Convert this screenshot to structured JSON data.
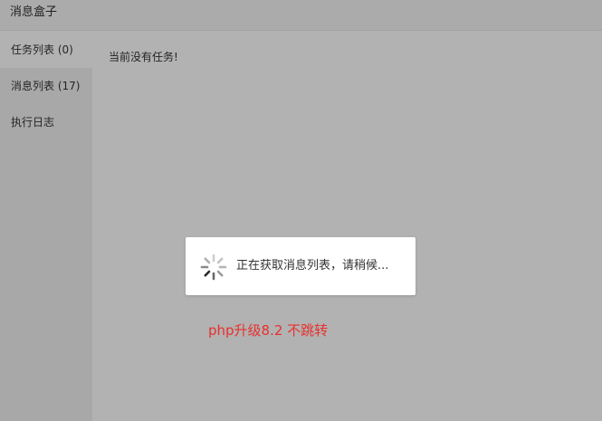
{
  "window": {
    "title": "消息盒子"
  },
  "sidebar": {
    "items": [
      {
        "label": "任务列表 (0)",
        "active": true
      },
      {
        "label": "消息列表 (17)",
        "active": false
      },
      {
        "label": "执行日志",
        "active": false
      }
    ]
  },
  "main": {
    "empty_text": "当前没有任务!"
  },
  "loading": {
    "text": "正在获取消息列表，请稍候...",
    "icon": "spinner-icon"
  },
  "annotation": {
    "text": "php升级8.2 不跳转",
    "color": "#e8302d"
  }
}
